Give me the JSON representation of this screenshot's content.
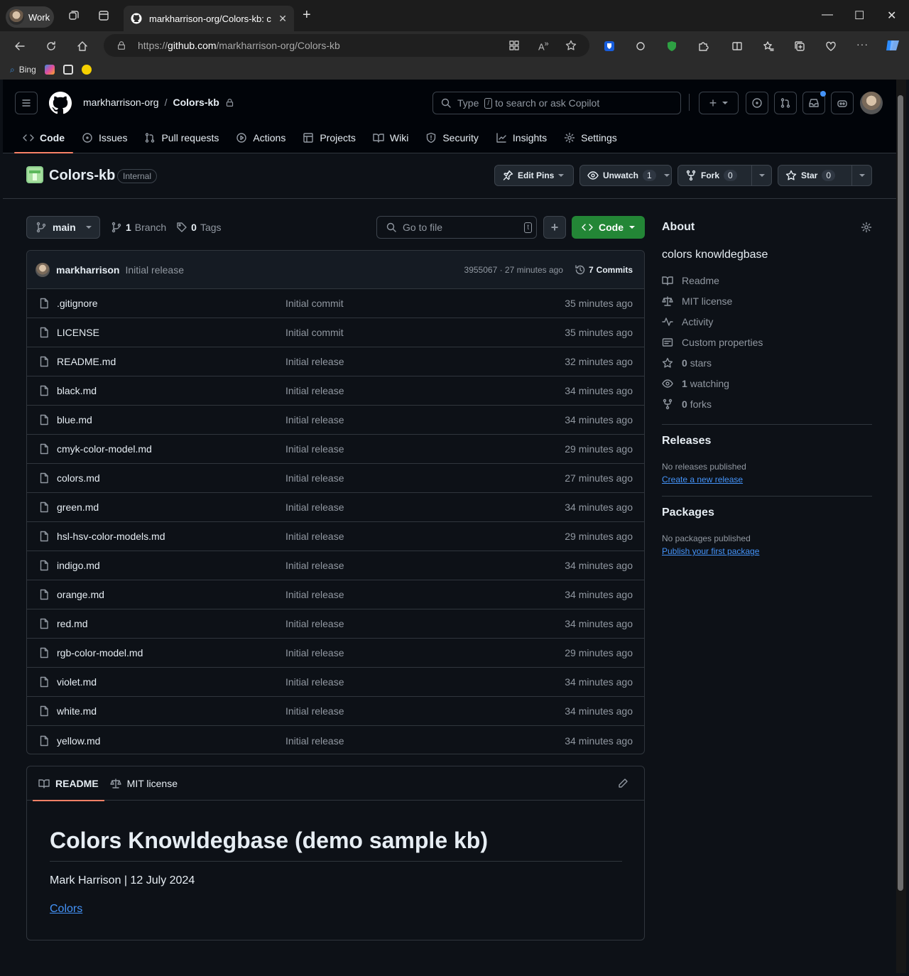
{
  "browser": {
    "profile_label": "Work",
    "tab_title": "markharrison-org/Colors-kb: colors knowldegbase",
    "url_prefix": "https://",
    "url_host": "github.com",
    "url_path": "/markharrison-org/Colors-kb",
    "favorites": [
      {
        "label": "Bing"
      }
    ]
  },
  "header": {
    "owner": "markharrison-org",
    "separator": "/",
    "repo": "Colors-kb",
    "search_placeholder_pre": "Type",
    "search_key": "/",
    "search_placeholder_post": "to search or ask Copilot"
  },
  "repo_nav": [
    {
      "label": "Code",
      "icon": "code-icon"
    },
    {
      "label": "Issues",
      "icon": "issue-icon"
    },
    {
      "label": "Pull requests",
      "icon": "pull-request-icon"
    },
    {
      "label": "Actions",
      "icon": "play-icon"
    },
    {
      "label": "Projects",
      "icon": "table-icon"
    },
    {
      "label": "Wiki",
      "icon": "book-icon"
    },
    {
      "label": "Security",
      "icon": "shield-icon"
    },
    {
      "label": "Insights",
      "icon": "graph-icon"
    },
    {
      "label": "Settings",
      "icon": "gear-icon"
    }
  ],
  "repo": {
    "name": "Colors-kb",
    "visibility": "Internal",
    "edit_pins": "Edit Pins",
    "unwatch": "Unwatch",
    "watch_count": "1",
    "fork": "Fork",
    "fork_count": "0",
    "star": "Star",
    "star_count": "0"
  },
  "toolbar": {
    "branch": "main",
    "branch_count": "1",
    "branch_label": "Branch",
    "tag_count": "0",
    "tag_label": "Tags",
    "goto_placeholder": "Go to file",
    "goto_key": "t",
    "code_button": "Code"
  },
  "commit": {
    "author": "markharrison",
    "message": "Initial release",
    "sha_time": "3955067 · 27 minutes ago",
    "commits_count": "7",
    "commits_label": "Commits"
  },
  "files": [
    {
      "name": ".gitignore",
      "message": "Initial commit",
      "time": "35 minutes ago"
    },
    {
      "name": "LICENSE",
      "message": "Initial commit",
      "time": "35 minutes ago"
    },
    {
      "name": "README.md",
      "message": "Initial release",
      "time": "32 minutes ago"
    },
    {
      "name": "black.md",
      "message": "Initial release",
      "time": "34 minutes ago"
    },
    {
      "name": "blue.md",
      "message": "Initial release",
      "time": "34 minutes ago"
    },
    {
      "name": "cmyk-color-model.md",
      "message": "Initial release",
      "time": "29 minutes ago"
    },
    {
      "name": "colors.md",
      "message": "Initial release",
      "time": "27 minutes ago"
    },
    {
      "name": "green.md",
      "message": "Initial release",
      "time": "34 minutes ago"
    },
    {
      "name": "hsl-hsv-color-models.md",
      "message": "Initial release",
      "time": "29 minutes ago"
    },
    {
      "name": "indigo.md",
      "message": "Initial release",
      "time": "34 minutes ago"
    },
    {
      "name": "orange.md",
      "message": "Initial release",
      "time": "34 minutes ago"
    },
    {
      "name": "red.md",
      "message": "Initial release",
      "time": "34 minutes ago"
    },
    {
      "name": "rgb-color-model.md",
      "message": "Initial release",
      "time": "29 minutes ago"
    },
    {
      "name": "violet.md",
      "message": "Initial release",
      "time": "34 minutes ago"
    },
    {
      "name": "white.md",
      "message": "Initial release",
      "time": "34 minutes ago"
    },
    {
      "name": "yellow.md",
      "message": "Initial release",
      "time": "34 minutes ago"
    }
  ],
  "readme": {
    "tab_readme": "README",
    "tab_license": "MIT license",
    "heading": "Colors Knowldegbase (demo sample kb)",
    "byline": "Mark Harrison | 12 July 2024",
    "link": "Colors"
  },
  "about": {
    "title": "About",
    "description": "colors knowldegbase",
    "links": [
      {
        "icon": "book-icon",
        "label": "Readme"
      },
      {
        "icon": "law-icon",
        "label": "MIT license"
      },
      {
        "icon": "pulse-icon",
        "label": "Activity"
      },
      {
        "icon": "note-icon",
        "label": "Custom properties"
      }
    ],
    "stats": [
      {
        "icon": "star-icon",
        "count": "0",
        "label": "stars"
      },
      {
        "icon": "eye-icon",
        "count": "1",
        "label": "watching"
      },
      {
        "icon": "fork-icon",
        "count": "0",
        "label": "forks"
      }
    ]
  },
  "releases": {
    "title": "Releases",
    "none": "No releases published",
    "create": "Create a new release"
  },
  "packages": {
    "title": "Packages",
    "none": "No packages published",
    "publish": "Publish your first package"
  },
  "colors": {
    "accent_underline": "#f78166",
    "code_button_bg": "#238636",
    "link": "#4493f8",
    "page_bg": "#0d1117"
  }
}
